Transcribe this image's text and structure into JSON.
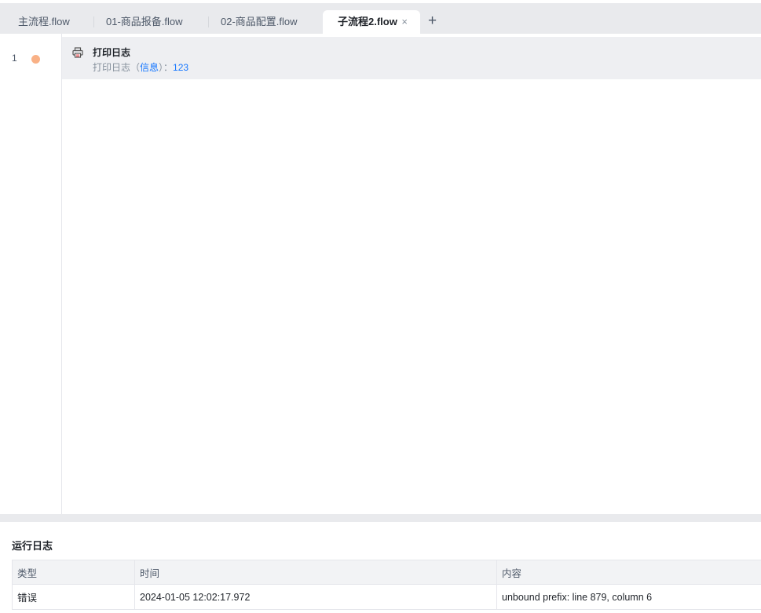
{
  "tabs": [
    {
      "label": "主流程.flow"
    },
    {
      "label": "01-商品报备.flow"
    },
    {
      "label": "02-商品配置.flow"
    },
    {
      "label": "子流程2.flow",
      "active": true
    }
  ],
  "tab_close": "×",
  "add_tab": "+",
  "editor": {
    "line_number": "1",
    "node": {
      "title": "打印日志",
      "sub_prefix": "打印日志（",
      "sub_level": "信息",
      "sub_mid": "）：",
      "sub_value": "123"
    }
  },
  "log_panel": {
    "title": "运行日志",
    "columns": [
      "类型",
      "时间",
      "内容"
    ],
    "rows": [
      [
        "错误",
        "2024-01-05 12:02:17.972",
        "unbound prefix: line 879, column 6"
      ]
    ]
  },
  "colors": {
    "accent": "#1677ff",
    "breakpoint": "#f9b186"
  }
}
